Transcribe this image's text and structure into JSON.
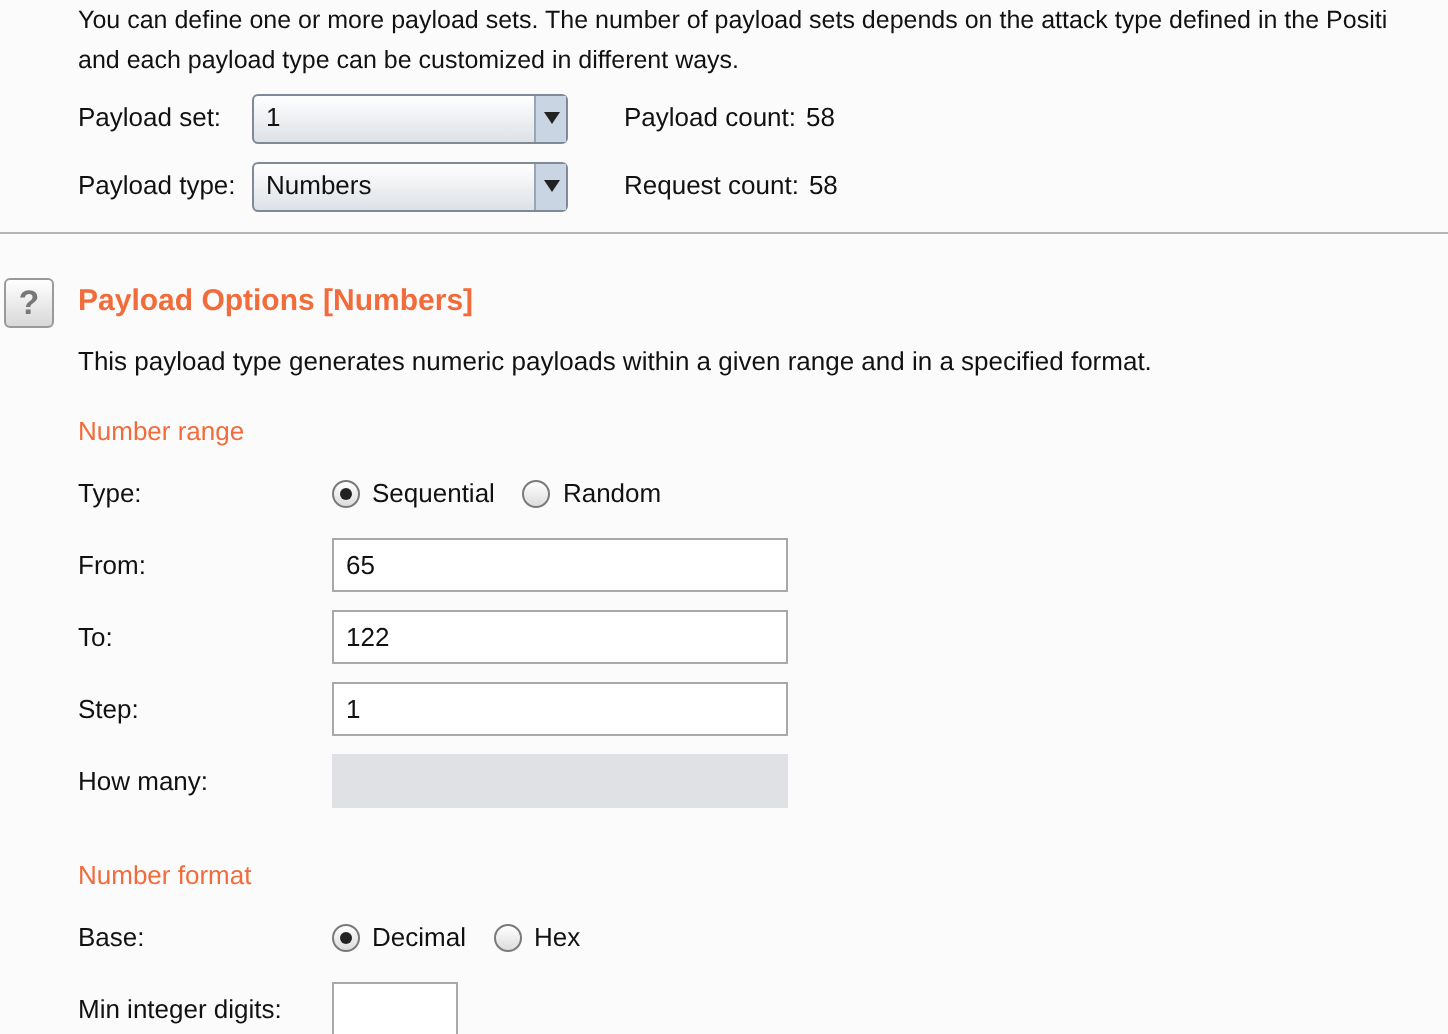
{
  "intro": [
    "You can define one or more payload sets. The number of payload sets depends on the attack type defined in the Positi",
    "and each payload type can be customized in different ways."
  ],
  "selectors": [
    {
      "label": "Payload set:",
      "value": "1",
      "count_label": "Payload count:",
      "count": "58"
    },
    {
      "label": "Payload type:",
      "value": "Numbers",
      "count_label": "Request count:",
      "count": "58"
    }
  ],
  "options": {
    "help_icon": "?",
    "title": "Payload Options [Numbers]",
    "description": "This payload type generates numeric payloads within a given range and in a specified format.",
    "sections": [
      {
        "title": "Number range",
        "fields": [
          {
            "kind": "radio",
            "label": "Type:",
            "options": [
              {
                "label": "Sequential",
                "selected": true
              },
              {
                "label": "Random",
                "selected": false
              }
            ]
          },
          {
            "kind": "text",
            "label": "From:",
            "value": "65",
            "disabled": false
          },
          {
            "kind": "text",
            "label": "To:",
            "value": "122",
            "disabled": false
          },
          {
            "kind": "text",
            "label": "Step:",
            "value": "1",
            "disabled": false
          },
          {
            "kind": "text",
            "label": "How many:",
            "disabled": true
          }
        ]
      },
      {
        "title": "Number format",
        "fields": [
          {
            "kind": "radio",
            "label": "Base:",
            "options": [
              {
                "label": "Decimal",
                "selected": true
              },
              {
                "label": "Hex",
                "selected": false
              }
            ]
          },
          {
            "kind": "short",
            "label": "Min integer digits:",
            "disabled": false
          }
        ]
      }
    ]
  }
}
